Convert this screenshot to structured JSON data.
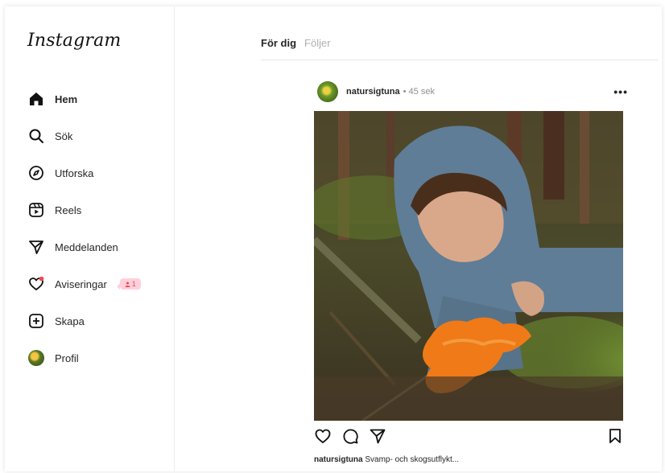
{
  "app": {
    "logo": "Instagram"
  },
  "sidebar": {
    "items": [
      {
        "label": "Hem",
        "icon": "home-icon"
      },
      {
        "label": "Sök",
        "icon": "search-icon"
      },
      {
        "label": "Utforska",
        "icon": "compass-icon"
      },
      {
        "label": "Reels",
        "icon": "reels-icon"
      },
      {
        "label": "Meddelanden",
        "icon": "send-icon"
      },
      {
        "label": "Aviseringar",
        "icon": "heart-icon",
        "badge": "1"
      },
      {
        "label": "Skapa",
        "icon": "plus-square-icon"
      },
      {
        "label": "Profil",
        "icon": "avatar"
      }
    ]
  },
  "feed": {
    "tabs": [
      {
        "label": "För dig"
      },
      {
        "label": "Följer"
      }
    ]
  },
  "post": {
    "username": "natursigtuna",
    "time": "• 45 sek",
    "more": "•••",
    "caption_user": "natursigtuna",
    "caption_text": "Svamp- och skogsutflykt..."
  },
  "colors": {
    "notification_red": "#ed4956",
    "badge_bg": "#ffd0dc",
    "mushroom_orange": "#f07a18"
  }
}
